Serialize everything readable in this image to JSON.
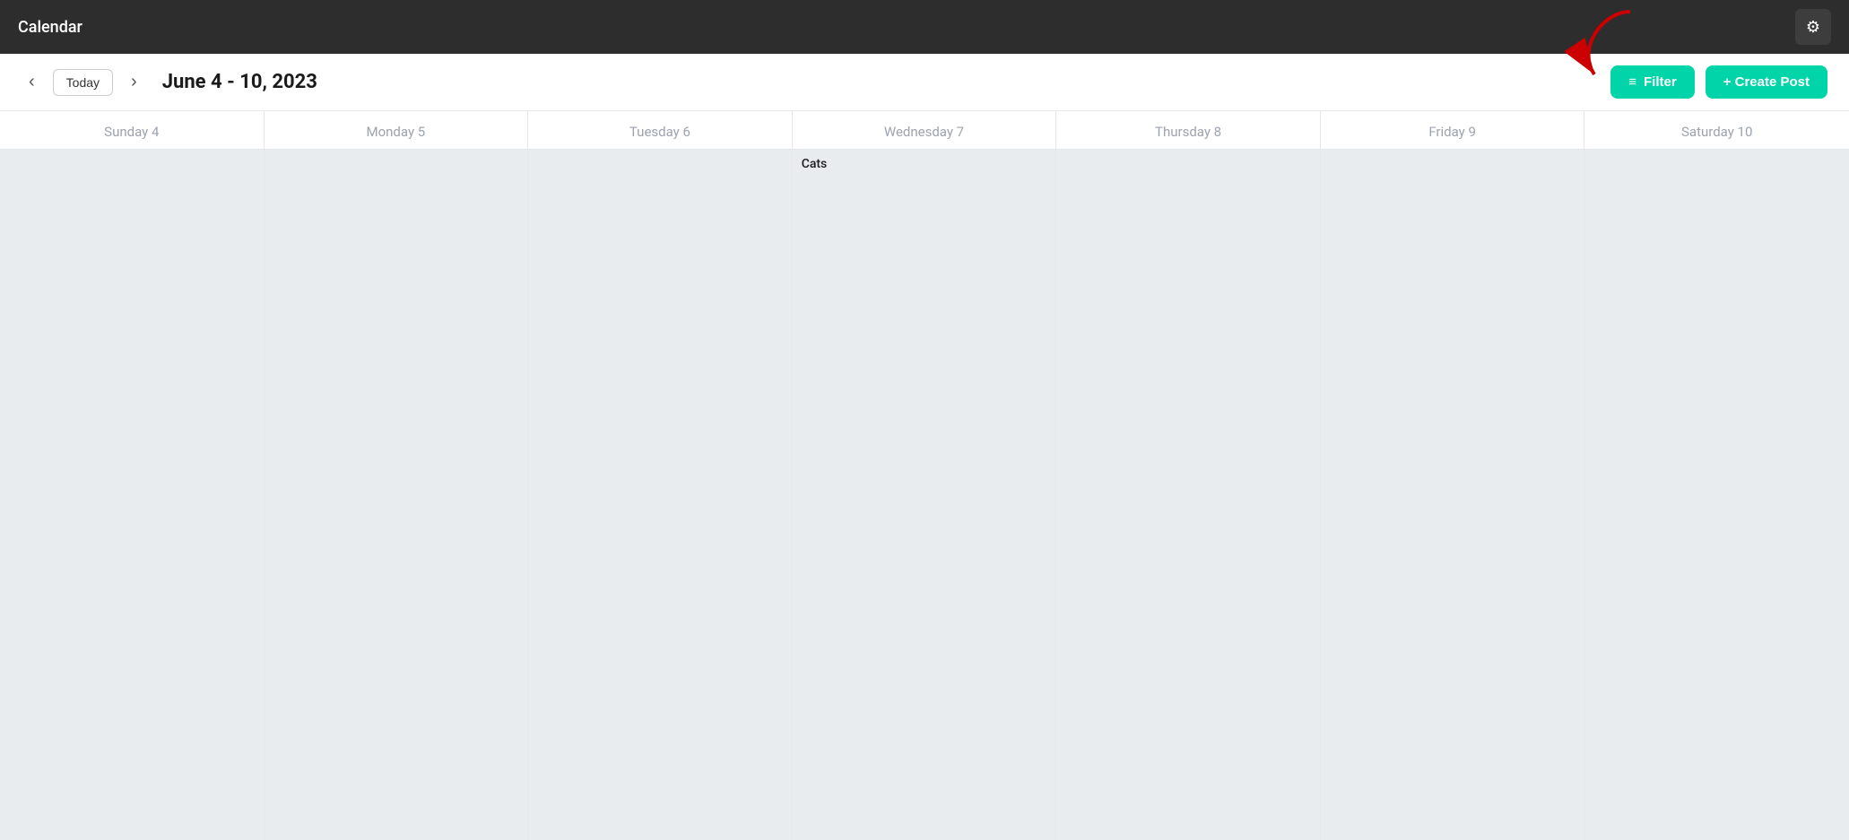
{
  "app": {
    "title": "Calendar"
  },
  "toolbar": {
    "today_label": "Today",
    "date_range": "June 4 - 10, 2023",
    "filter_label": "Filter",
    "create_post_label": "+ Create Post"
  },
  "calendar": {
    "days": [
      {
        "label": "Sunday 4",
        "has_cats": false
      },
      {
        "label": "Monday 5",
        "has_cats": false
      },
      {
        "label": "Tuesday 6",
        "has_cats": false
      },
      {
        "label": "Wednesday 7",
        "has_cats": true
      },
      {
        "label": "Thursday 8",
        "has_cats": false
      },
      {
        "label": "Friday 9",
        "has_cats": false
      },
      {
        "label": "Saturday 10",
        "has_cats": false
      }
    ],
    "cats_label": "Cats"
  },
  "icons": {
    "settings": "⚙",
    "filter_lines": "≡",
    "prev": "‹",
    "next": "›"
  }
}
